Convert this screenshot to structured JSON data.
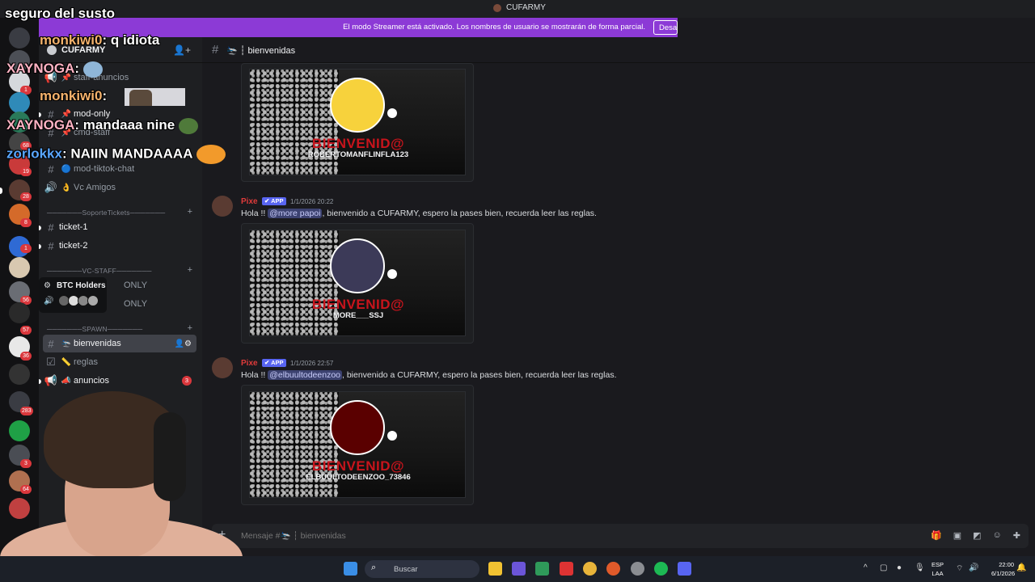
{
  "window": {
    "app_title": "CUFARMY"
  },
  "banner": {
    "text": "El modo Streamer está activado. Los nombres de usuario se mostrarán de forma parcial.",
    "button": "Desac"
  },
  "server": {
    "name": "CUFARMY"
  },
  "sidebar": {
    "channels": [
      {
        "name": "staff-anuncios",
        "emoji": "📌"
      },
      {
        "name": "mod-only",
        "emoji": "📌"
      },
      {
        "name": "cmd-staff",
        "emoji": "📌"
      },
      {
        "name": "mod-tiktok-chat",
        "emoji": "🔵"
      },
      {
        "name": "Vc Amigos",
        "emoji": "👌"
      },
      {
        "name": "ticket-1",
        "emoji": ""
      },
      {
        "name": "ticket-2",
        "emoji": ""
      },
      {
        "name": "ONLY",
        "emoji": ""
      },
      {
        "name": "ONLY",
        "emoji": ""
      },
      {
        "name": "bienvenidas",
        "emoji": "🛬"
      },
      {
        "name": "reglas",
        "emoji": "📏"
      },
      {
        "name": "anuncios",
        "emoji": "📣"
      }
    ],
    "categories": [
      "───────SoporteTickets───────",
      "───────VC-STAFF───────",
      "───────SPAWN───────"
    ],
    "anuncios_mentions": "3"
  },
  "tooltip": {
    "name": "BTC Holders"
  },
  "chat": {
    "channel_name": "bienvenidas",
    "messages": [
      {
        "author": "Pixe",
        "tag": "APP",
        "time": "1/1/2026 20:22",
        "pre": "Hola !! ",
        "mention": "@more papoi",
        "post": ", bienvenido a CUFARMY, espero la pases bien, recuerda leer las reglas.",
        "image_title": "BIENVENID@",
        "image_user": "MORE___SSJ"
      },
      {
        "author": "Pixe",
        "tag": "APP",
        "time": "1/1/2026 22:57",
        "pre": "Hola !! ",
        "mention": "@elbuultodeenzoo",
        "post": ", bienvenido a CUFARMY, espero la pases bien, recuerda leer las reglas.",
        "image_title": "BIENVENID@",
        "image_user": "ELBUULTODEENZOO_73846"
      }
    ],
    "first_image": {
      "image_title": "BIENVENID@",
      "image_user": "ROBERTOMANFLINFLA123"
    },
    "composer_placeholder": "Mensaje #🛬 ┆ bienvenidas"
  },
  "overlay": {
    "title": "seguro del susto",
    "lines": [
      {
        "user": "monkiwi0",
        "text": ": q idiota",
        "variant": "m"
      },
      {
        "user": "XAYNOGA",
        "text": ":",
        "variant": "x"
      },
      {
        "user": "monkiwi0",
        "text": ":",
        "variant": "m"
      },
      {
        "user": "XAYNOGA",
        "text": ": mandaaa nine",
        "variant": "x"
      },
      {
        "user": "zorlokkx",
        "text": ": NAIIN MANDAAAA",
        "variant": "z"
      }
    ]
  },
  "rail": {
    "badges": [
      "1",
      "68",
      "19",
      "28",
      "8",
      "1",
      "56",
      "57",
      "36",
      "283",
      "3",
      "64"
    ]
  },
  "taskbar": {
    "search": "Buscar",
    "lang_line1": "ESP",
    "lang_line2": "LAA",
    "time": "22:00",
    "date": "6/1/2026"
  },
  "colors": {
    "banner": "#8c3ad6",
    "author": "#e03b3b",
    "app_tag": "#5865f2",
    "mention_badge": "#da373c"
  }
}
